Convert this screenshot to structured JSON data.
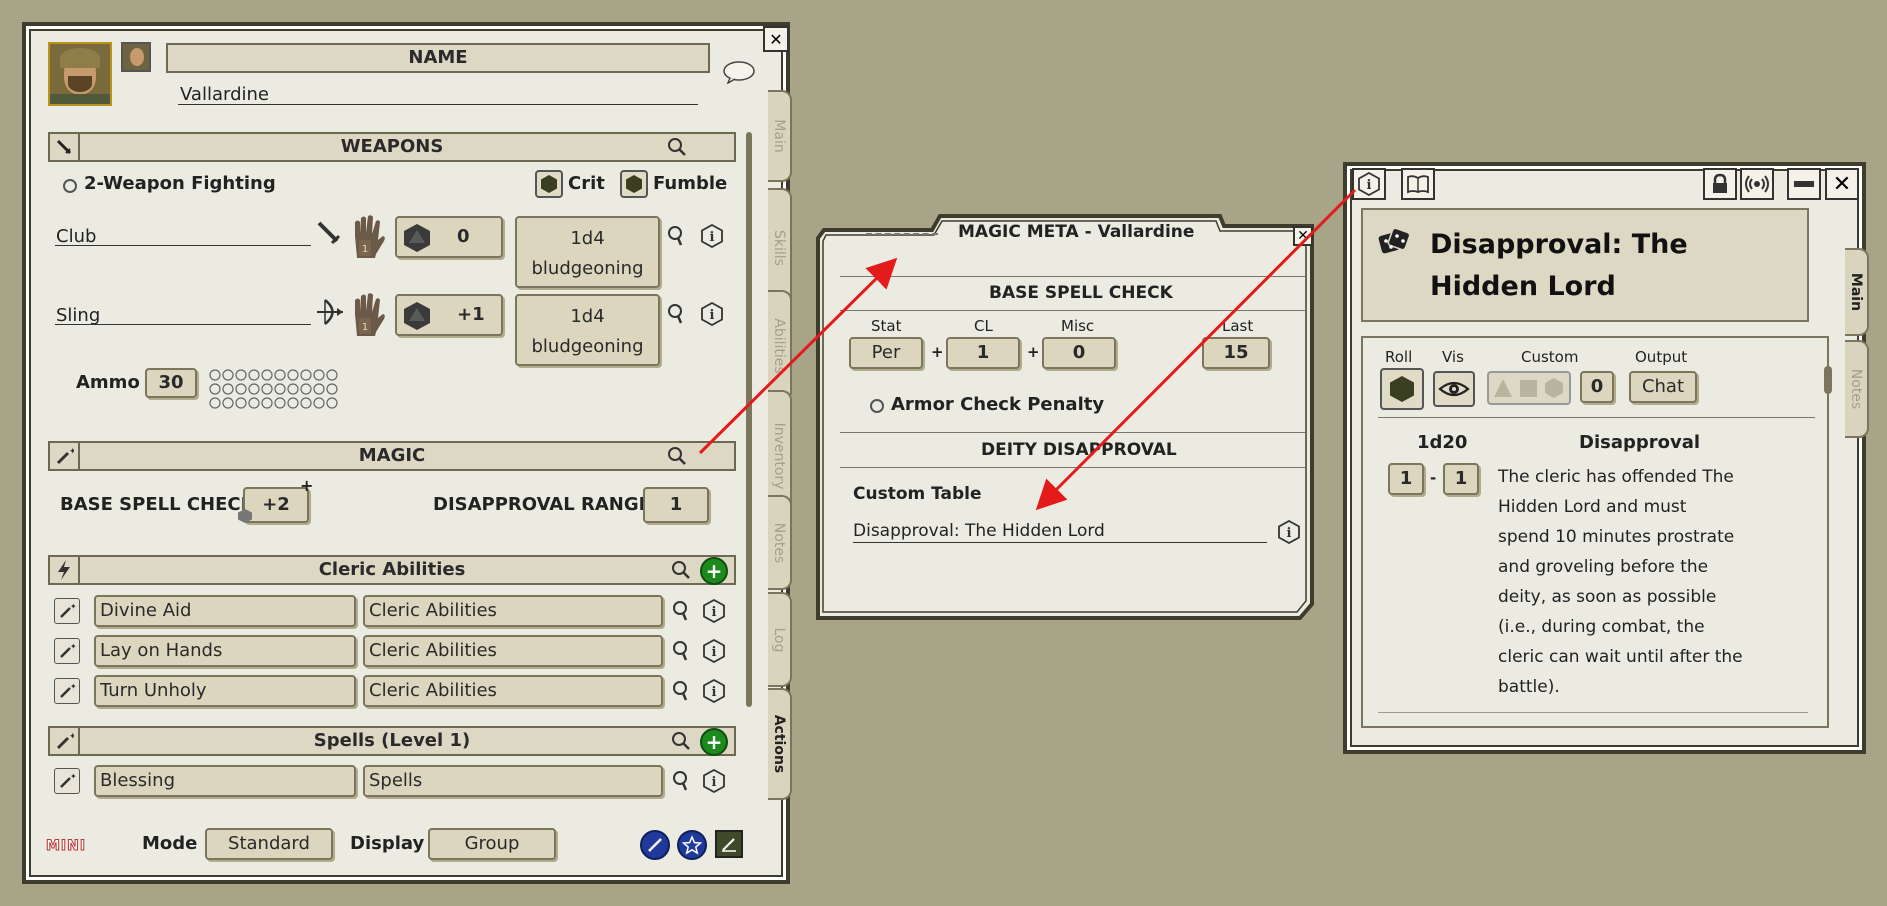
{
  "character": {
    "name_header": "NAME",
    "name": "Vallardine",
    "tabs": [
      "Main",
      "Skills",
      "Abilities",
      "Inventory",
      "Notes",
      "Log",
      "Actions"
    ],
    "weapons": {
      "header": "WEAPONS",
      "two_weapon_label": "2-Weapon Fighting",
      "crit_label": "Crit",
      "fumble_label": "Fumble",
      "items": [
        {
          "name": "Club",
          "hand": "1",
          "bonus": "0",
          "damage": "1d4",
          "damage_type": "bludgeoning"
        },
        {
          "name": "Sling",
          "hand": "1",
          "bonus": "+1",
          "damage": "1d4",
          "damage_type": "bludgeoning"
        }
      ],
      "ammo_label": "Ammo",
      "ammo_value": "30"
    },
    "magic": {
      "header": "MAGIC",
      "base_spell_check_label": "BASE SPELL CHECK",
      "base_spell_check_value": "+2",
      "disapproval_range_label": "DISAPPROVAL RANGE",
      "disapproval_range_value": "1"
    },
    "cleric_abilities": {
      "header": "Cleric Abilities",
      "items": [
        {
          "name": "Divine Aid",
          "group": "Cleric Abilities"
        },
        {
          "name": "Lay on Hands",
          "group": "Cleric Abilities"
        },
        {
          "name": "Turn Unholy",
          "group": "Cleric Abilities"
        }
      ]
    },
    "spells": {
      "header": "Spells (Level 1)",
      "items": [
        {
          "name": "Blessing",
          "group": "Spells"
        }
      ]
    },
    "footer": {
      "mini_label": "MINI",
      "mode_label": "Mode",
      "mode_value": "Standard",
      "display_label": "Display",
      "display_value": "Group"
    }
  },
  "meta": {
    "title": "MAGIC META - Vallardine",
    "base_spell_check_header": "BASE SPELL CHECK",
    "stat_label": "Stat",
    "cl_label": "CL",
    "misc_label": "Misc",
    "last_label": "Last",
    "stat_value": "Per",
    "cl_value": "1",
    "misc_value": "0",
    "last_value": "15",
    "plus1": "+",
    "plus2": "+",
    "armor_check_label": "Armor Check Penalty",
    "deity_header": "DEITY DISAPPROVAL",
    "custom_table_label": "Custom Table",
    "custom_table_value": "Disapproval: The Hidden Lord"
  },
  "table": {
    "title": "Disapproval: The Hidden Lord",
    "tabs": [
      "Main",
      "Notes"
    ],
    "roll_label": "Roll",
    "vis_label": "Vis",
    "custom_label": "Custom",
    "output_label": "Output",
    "custom_value": "0",
    "output_value": "Chat",
    "dice_header": "1d20",
    "result_header": "Disapproval",
    "range_from": "1",
    "range_to": "1",
    "range_dash": "-",
    "result_text": [
      "The cleric has offended The",
      "Hidden Lord and must",
      "spend 10 minutes prostrate",
      "and groveling before the",
      "deity, as soon as possible",
      "(i.e., during combat, the",
      "cleric can wait until after the",
      "battle)."
    ]
  },
  "colors": {
    "background": "#a8a488",
    "window": "#ecebe1",
    "frame": "#3e3c2a",
    "arrow": "#e41b1b",
    "green": "#1d8a1d",
    "blue": "#1f3a9a"
  }
}
